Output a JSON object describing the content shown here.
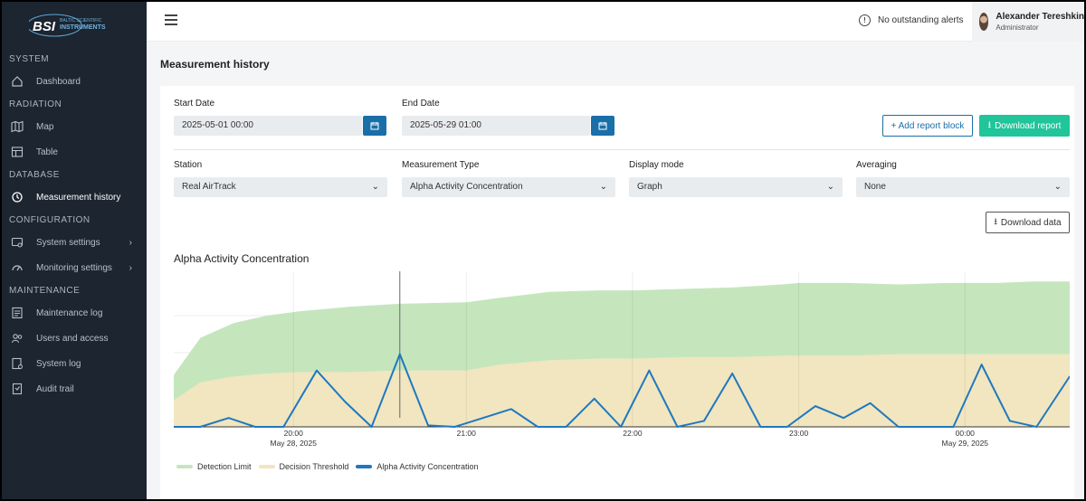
{
  "brand": {
    "name": "BSI",
    "tagline_top": "BALTIC SCIENTIFIC",
    "tagline_bottom": "INSTRUMENTS"
  },
  "sidebar": {
    "sections": [
      {
        "title": "SYSTEM",
        "items": [
          {
            "label": "Dashboard",
            "icon": "home-icon"
          }
        ]
      },
      {
        "title": "RADIATION",
        "items": [
          {
            "label": "Map",
            "icon": "map-icon"
          },
          {
            "label": "Table",
            "icon": "table-icon"
          }
        ]
      },
      {
        "title": "DATABASE",
        "items": [
          {
            "label": "Measurement history",
            "icon": "history-icon",
            "active": true
          }
        ]
      },
      {
        "title": "CONFIGURATION",
        "items": [
          {
            "label": "System settings",
            "icon": "settings-icon",
            "chevron": true
          },
          {
            "label": "Monitoring settings",
            "icon": "gauge-icon",
            "chevron": true
          }
        ]
      },
      {
        "title": "MAINTENANCE",
        "items": [
          {
            "label": "Maintenance log",
            "icon": "log-icon"
          },
          {
            "label": "Users and access",
            "icon": "users-icon"
          },
          {
            "label": "System log",
            "icon": "system-log-icon"
          },
          {
            "label": "Audit trail",
            "icon": "audit-icon"
          }
        ]
      }
    ]
  },
  "header": {
    "alerts": "No outstanding alerts",
    "user": {
      "name": "Alexander Tereshkin",
      "role": "Administrator"
    }
  },
  "page": {
    "title": "Measurement history",
    "start_date": {
      "label": "Start Date",
      "value": "2025-05-01 00:00"
    },
    "end_date": {
      "label": "End Date",
      "value": "2025-05-29 01:00"
    },
    "add_report_block": "+ Add report block",
    "download_report": "Download report",
    "filters": {
      "station": {
        "label": "Station",
        "value": "Real AirTrack"
      },
      "measurement_type": {
        "label": "Measurement Type",
        "value": "Alpha Activity Concentration"
      },
      "display_mode": {
        "label": "Display mode",
        "value": "Graph"
      },
      "averaging": {
        "label": "Averaging",
        "value": "None"
      }
    },
    "download_data": "Download data"
  },
  "colors": {
    "sidebar_bg": "#1c2530",
    "primary": "#1a6fa8",
    "success": "#21c59a",
    "detection": "#c5e6bd",
    "threshold": "#f1e6bf",
    "series": "#1f78c1"
  },
  "chart_data": {
    "type": "area",
    "title": "Alpha Activity Concentration",
    "x_ticks": [
      {
        "label": "20:00",
        "sublabel": "May 28, 2025",
        "x": 19.96
      },
      {
        "label": "21:00",
        "sublabel": "",
        "x": 21
      },
      {
        "label": "22:00",
        "sublabel": "",
        "x": 22
      },
      {
        "label": "23:00",
        "sublabel": "",
        "x": 23
      },
      {
        "label": "00:00",
        "sublabel": "May 29, 2025",
        "x": 24
      }
    ],
    "xlim": [
      19.24,
      24.63
    ],
    "ylim": [
      0,
      1
    ],
    "y_axis_labels": false,
    "grid": true,
    "legend_position": "bottom-left",
    "crosshair_x": 20.6,
    "series": [
      {
        "name": "Detection Limit",
        "style": "area",
        "color": "#c5e6bd",
        "x": [
          19.24,
          19.4,
          19.6,
          19.8,
          20.0,
          20.3,
          20.6,
          21.0,
          21.2,
          21.5,
          21.8,
          22.0,
          22.3,
          22.6,
          22.9,
          23.0,
          23.3,
          23.6,
          23.9,
          24.2,
          24.4,
          24.63
        ],
        "values": [
          0.35,
          0.6,
          0.7,
          0.75,
          0.78,
          0.81,
          0.83,
          0.84,
          0.87,
          0.91,
          0.92,
          0.92,
          0.93,
          0.94,
          0.96,
          0.97,
          0.97,
          0.96,
          0.97,
          0.97,
          0.98,
          0.98
        ]
      },
      {
        "name": "Decision Threshold",
        "style": "area",
        "color": "#f1e6bf",
        "x": [
          19.24,
          19.4,
          19.6,
          19.8,
          20.0,
          20.3,
          20.6,
          21.0,
          21.2,
          21.5,
          21.8,
          22.0,
          22.3,
          22.6,
          22.9,
          23.0,
          23.3,
          23.6,
          23.9,
          24.2,
          24.4,
          24.63
        ],
        "values": [
          0.18,
          0.3,
          0.34,
          0.36,
          0.37,
          0.37,
          0.38,
          0.38,
          0.42,
          0.45,
          0.46,
          0.46,
          0.47,
          0.47,
          0.48,
          0.48,
          0.48,
          0.49,
          0.49,
          0.49,
          0.49,
          0.49
        ]
      },
      {
        "name": "Alpha Activity Concentration",
        "style": "line",
        "color": "#1f78c1",
        "x": [
          19.24,
          19.4,
          19.57,
          19.73,
          19.9,
          20.1,
          20.27,
          20.43,
          20.6,
          20.77,
          20.93,
          21.1,
          21.27,
          21.43,
          21.6,
          21.77,
          21.93,
          22.1,
          22.27,
          22.43,
          22.6,
          22.77,
          22.93,
          23.1,
          23.27,
          23.43,
          23.6,
          23.77,
          23.93,
          24.1,
          24.27,
          24.43,
          24.63
        ],
        "values": [
          0,
          0,
          0.06,
          0,
          0,
          0.38,
          0.17,
          0,
          0.49,
          0.01,
          0,
          0.06,
          0.12,
          0,
          0,
          0.19,
          0,
          0.38,
          0,
          0.04,
          0.36,
          0,
          0,
          0.14,
          0.06,
          0.16,
          0,
          0,
          0,
          0.42,
          0.04,
          0,
          0.34
        ]
      }
    ]
  }
}
